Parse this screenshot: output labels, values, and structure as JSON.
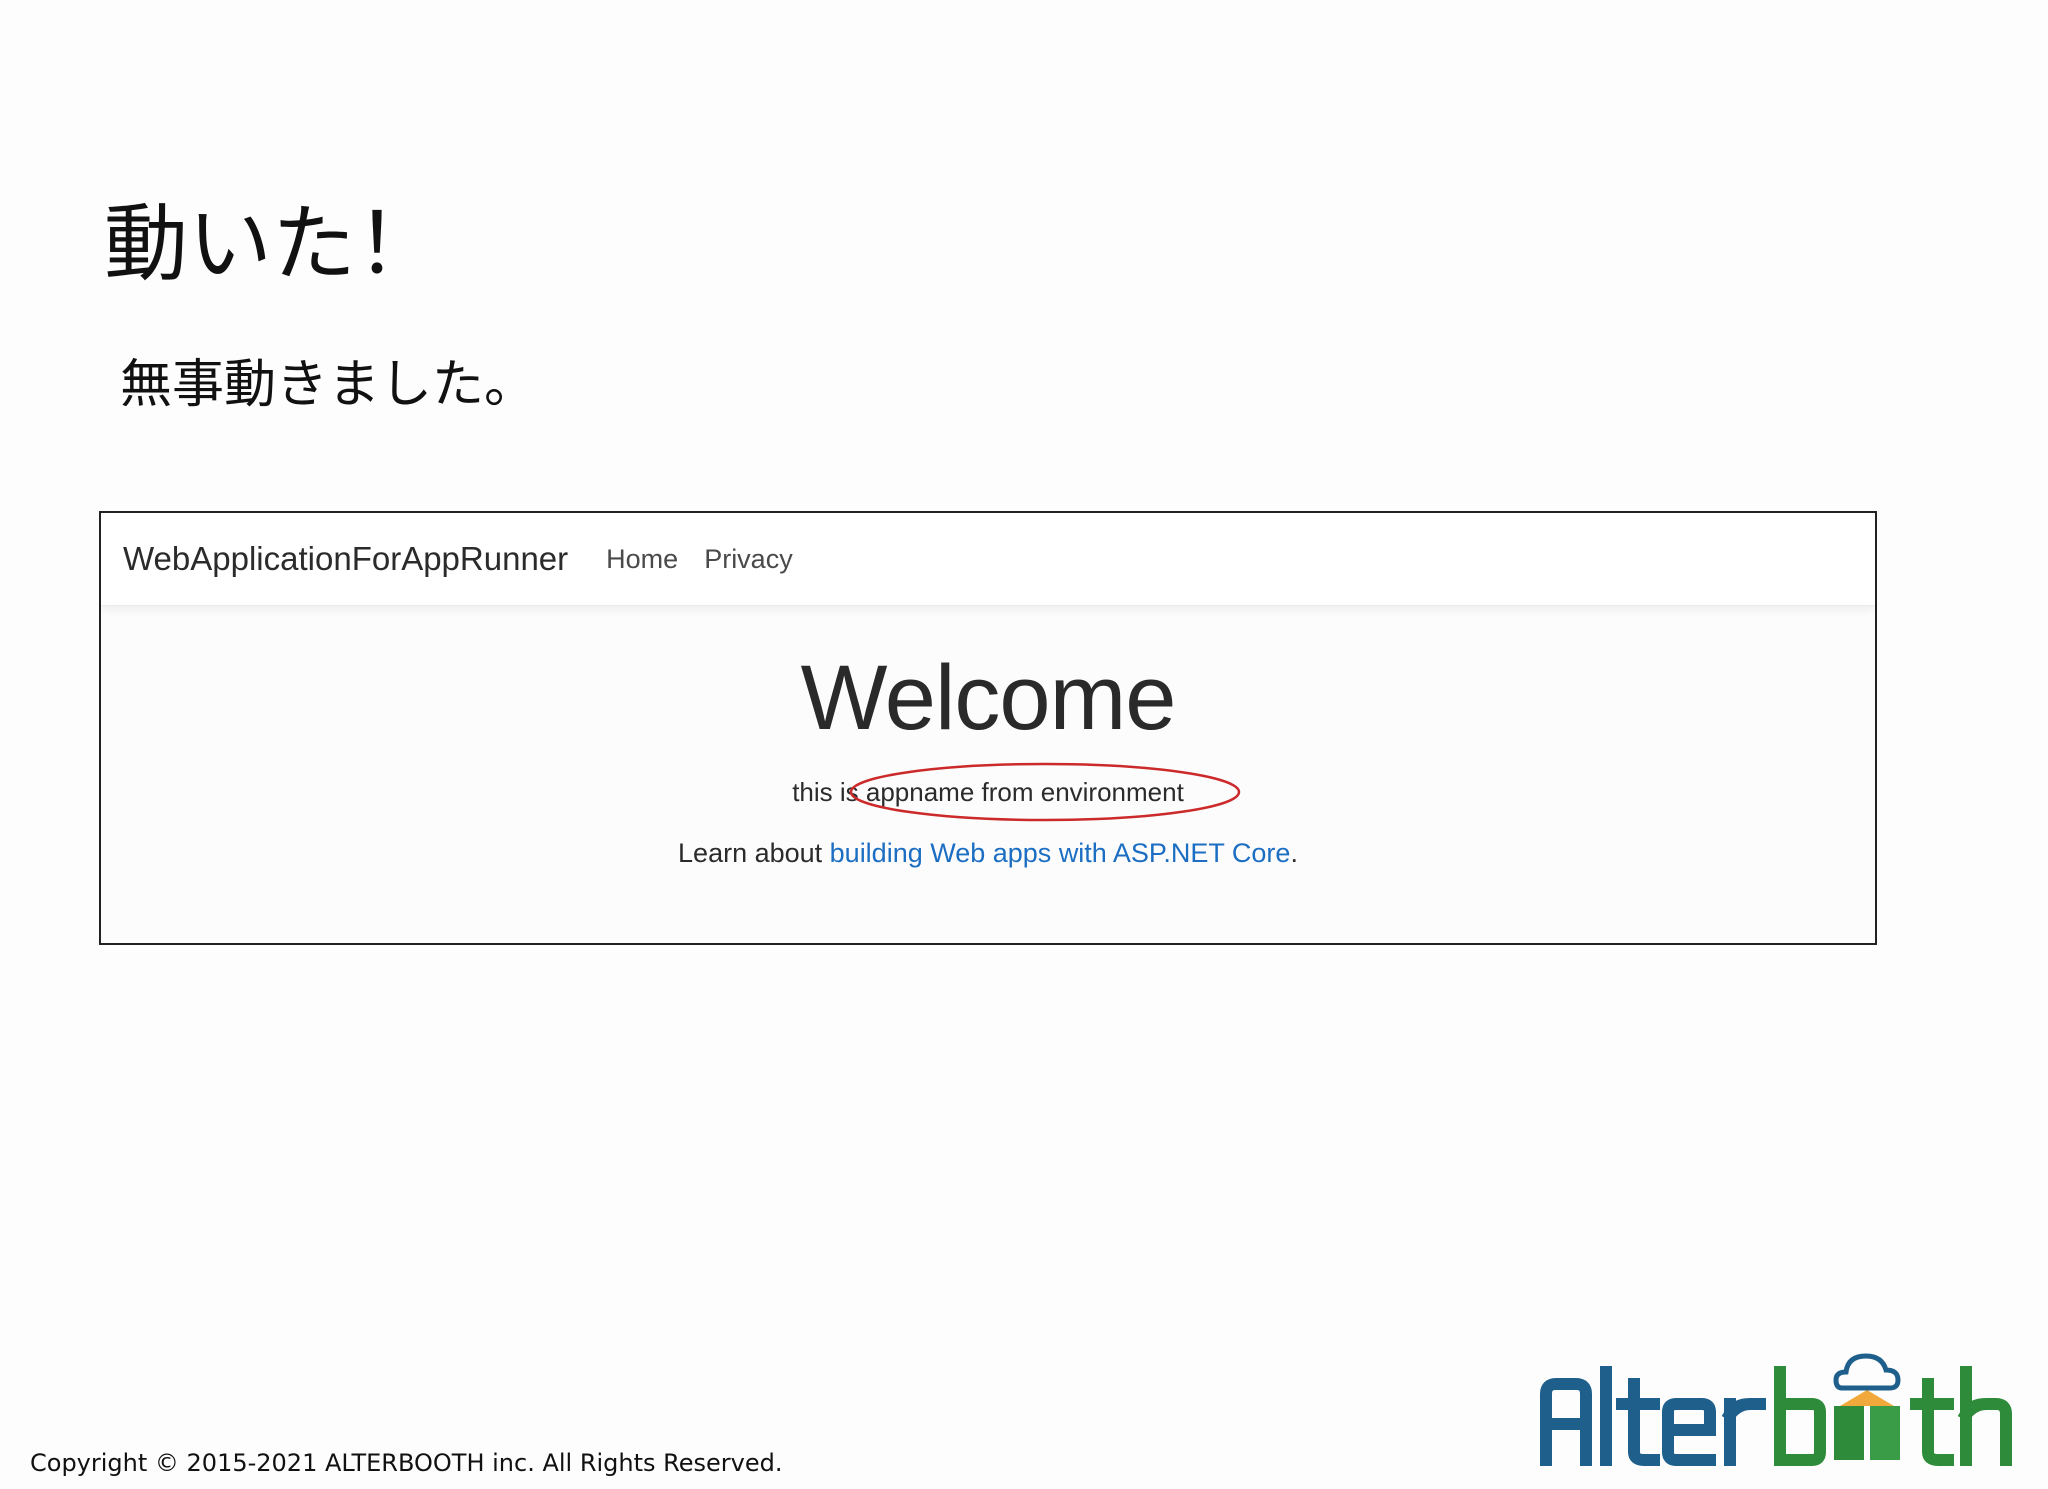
{
  "slide": {
    "title": "動いた！",
    "subtitle": "無事動きました。",
    "copyright": "Copyright © 2015-2021 ALTERBOOTH inc. All Rights Reserved.",
    "logo_text": "Alterbooth"
  },
  "app": {
    "brand": "WebApplicationForAppRunner",
    "nav": [
      {
        "label": "Home"
      },
      {
        "label": "Privacy"
      }
    ],
    "welcome_heading": "Welcome",
    "env_line": "this is appname from environment",
    "learn_prefix": "Learn about ",
    "learn_link": "building Web apps with ASP.NET Core",
    "learn_suffix": "."
  },
  "colors": {
    "link": "#1b6ec2",
    "annotation_ellipse": "#cc2a2a",
    "logo_blue": "#1f5f8b",
    "logo_green": "#2e8b3a"
  }
}
